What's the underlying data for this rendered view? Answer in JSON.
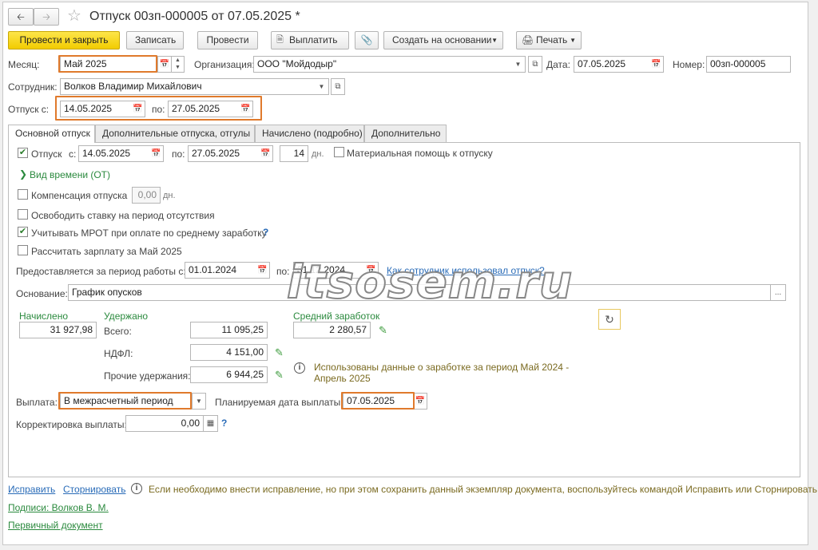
{
  "window": {
    "title": "Отпуск 00зп-000005 от 07.05.2025 *"
  },
  "toolbar": {
    "post_close": "Провести и закрыть",
    "save": "Записать",
    "post": "Провести",
    "pay": "Выплатить",
    "create_based": "Создать на основании",
    "print": "Печать"
  },
  "header": {
    "month_label": "Месяц:",
    "month_value": "Май 2025",
    "org_label": "Организация:",
    "org_value": "ООО \"Мойдодыр\"",
    "date_label": "Дата:",
    "date_value": "07.05.2025",
    "number_label": "Номер:",
    "number_value": "00зп-000005",
    "employee_label": "Сотрудник:",
    "employee_value": "Волков Владимир Михайлович",
    "vac_from_label": "Отпуск с:",
    "vac_from_value": "14.05.2025",
    "vac_to_label": "по:",
    "vac_to_value": "27.05.2025"
  },
  "tabs": [
    {
      "label": "Основной отпуск"
    },
    {
      "label": "Дополнительные отпуска, отгулы"
    },
    {
      "label": "Начислено (подробно)"
    },
    {
      "label": "Дополнительно"
    }
  ],
  "main": {
    "vacation_check": "Отпуск",
    "from_label": "с:",
    "from_value": "14.05.2025",
    "to_label": "по:",
    "to_value": "27.05.2025",
    "days_value": "14",
    "days_unit": "дн.",
    "material_help": "Материальная помощь к отпуску",
    "time_type": "Вид времени (ОТ)",
    "compensation": "Компенсация отпуска",
    "compensation_value": "0,00",
    "compensation_unit": "дн.",
    "release_rate": "Освободить ставку на период отсутствия",
    "consider_mrot": "Учитывать МРОТ при оплате по среднему заработку",
    "calc_salary": "Рассчитать зарплату за Май 2025",
    "period_label": "Предоставляется за период работы с:",
    "period_from": "01.01.2024",
    "period_to_label": "по:",
    "period_to": "31.12.2024",
    "how_used_link": "Как сотрудник использовал отпуск?",
    "basis_label": "Основание:",
    "basis_value": "График опусков",
    "accrued_title": "Начислено",
    "accrued_value": "31 927,98",
    "withheld_title": "Удержано",
    "total_label": "Всего:",
    "total_value": "11 095,25",
    "ndfl_label": "НДФЛ:",
    "ndfl_value": "4 151,00",
    "other_label": "Прочие удержания:",
    "other_value": "6 944,25",
    "avg_title": "Средний заработок",
    "avg_value": "2 280,57",
    "earnings_info": "Использованы данные о заработке за период Май 2024 - Апрель 2025",
    "payment_label": "Выплата:",
    "payment_value": "В межрасчетный период",
    "planned_date_label": "Планируемая дата выплаты:",
    "planned_date_value": "07.05.2025",
    "correction_label": "Корректировка выплаты:",
    "correction_value": "0,00"
  },
  "footer": {
    "fix_link": "Исправить",
    "reverse_link": "Сторнировать",
    "fix_info": "Если необходимо внести исправление, но при этом сохранить данный экземпляр документа, воспользуйтесь командой Исправить или Сторнировать",
    "signatures_link": "Подписи: Волков В. М.",
    "primary_doc_link": "Первичный документ"
  },
  "watermark": "itsosem.ru"
}
